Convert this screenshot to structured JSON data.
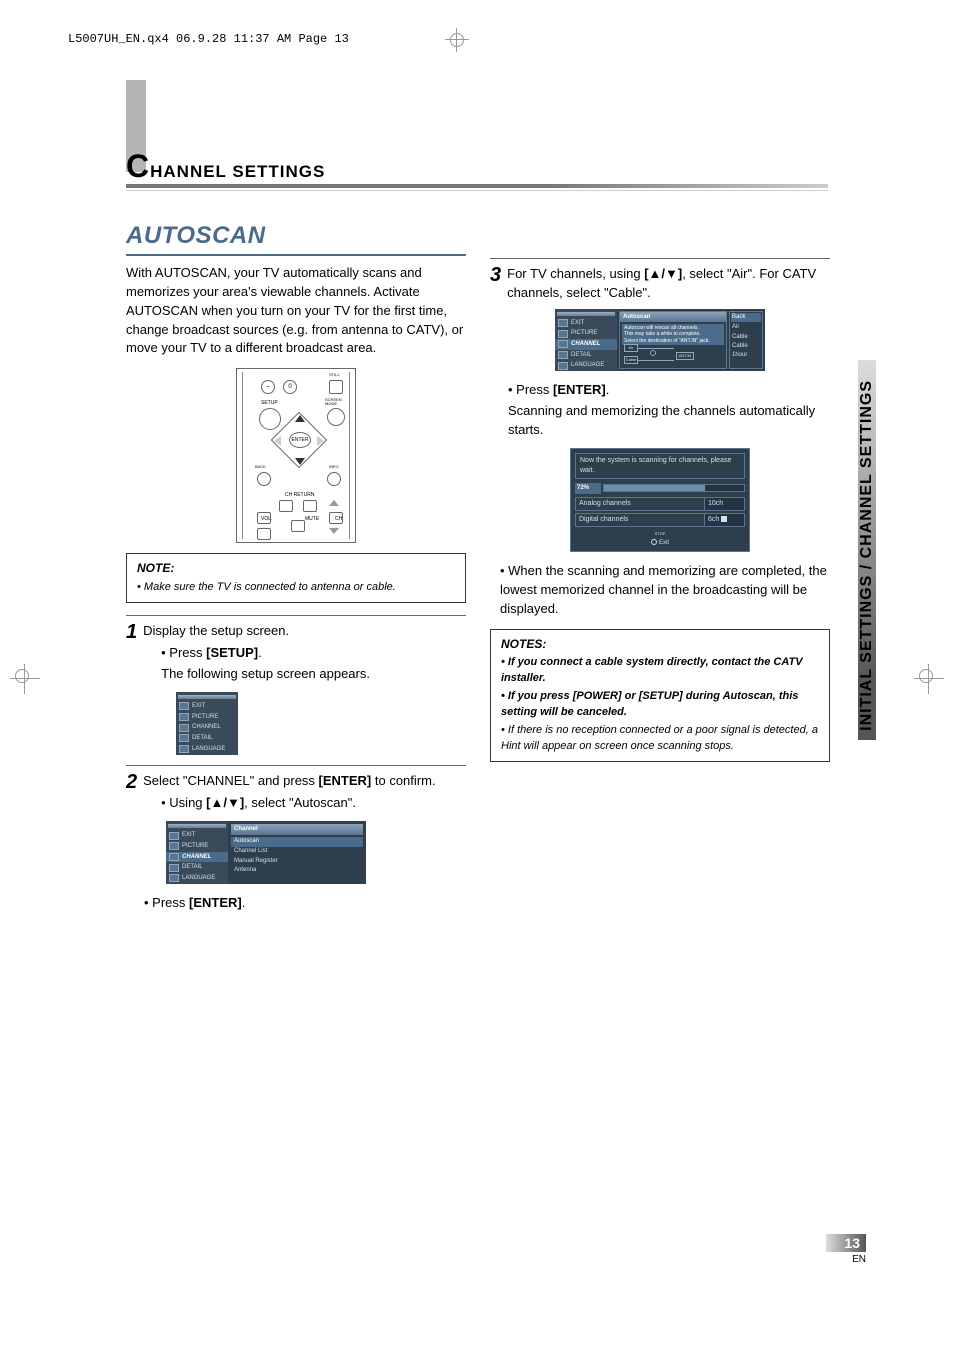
{
  "header": "L5007UH_EN.qx4  06.9.28  11:37 AM  Page 13",
  "chapter_title": "HANNEL SETTINGS",
  "section_title": "AUTOSCAN",
  "intro": "With AUTOSCAN, your TV automatically scans and memorizes your area's viewable channels. Activate AUTOSCAN when you turn on your TV for the first time, change broadcast sources (e.g. from antenna to CATV), or move your TV to a different broadcast area.",
  "remote": {
    "still": "STILL",
    "setup": "SETUP",
    "screen_mode": "SCREEN MODE",
    "enter": "ENTER",
    "back": "BACK",
    "info": "INFO",
    "ch_return": "CH RETURN",
    "vol": "VOL.",
    "mute": "MUTE",
    "ch": "CH"
  },
  "note1": {
    "heading": "NOTE:",
    "body": "• Make sure the TV is connected to antenna or cable."
  },
  "step1": {
    "num": "1",
    "text": "Display the setup screen.",
    "bullet": "• Press ",
    "bold": "[SETUP]",
    "after": ".",
    "sub": "The following setup screen appears."
  },
  "osd_menu": {
    "items": [
      "EXIT",
      "PICTURE",
      "CHANNEL",
      "DETAIL",
      "LANGUAGE"
    ]
  },
  "step2": {
    "num": "2",
    "text_a": "Select \"CHANNEL\" and press ",
    "bold": "[ENTER]",
    "text_b": " to confirm.",
    "bullet_a": "• Using ",
    "bullet_bold": "[▲/▼]",
    "bullet_b": ", select \"Autoscan\"."
  },
  "osd_channel": {
    "title": "Channel",
    "items": [
      "Autoscan",
      "Channel List",
      "Manual Register",
      "Antenna"
    ]
  },
  "step2b": {
    "bullet": "• Press ",
    "bold": "[ENTER]",
    "after": "."
  },
  "step3": {
    "num": "3",
    "text_a": "For TV channels, using ",
    "bold": "[▲/▼]",
    "text_b": ", select \"Air\". For CATV channels, select \"Cable\"."
  },
  "osd_autoscan": {
    "title": "Autoscan",
    "msg1": "Autoscan will rescan all channels.",
    "msg2": "This may take a while to complete.",
    "msg3": "Select the destination of \"ANT.IN\" jack.",
    "air": "Air",
    "cable": "Cable",
    "antin": "ANT.IN",
    "side": [
      "Back",
      "Air",
      "Cable",
      "Cable 1hour"
    ]
  },
  "scan": {
    "msg": "Now the system is scanning for channels, please wait.",
    "pct_label": "72%",
    "pct_value": 72,
    "analog_label": "Analog channels",
    "analog_val": "10ch",
    "digital_label": "Digital channels",
    "digital_val": "6ch",
    "stop": "STOP",
    "exit": "Exit"
  },
  "after_scan": {
    "bullet": "• Press ",
    "bold": "[ENTER]",
    "after": ".",
    "sub": "Scanning and memorizing the channels automatically starts."
  },
  "completion": "• When the scanning and memorizing are completed, the lowest memorized channel in the broadcasting will be displayed.",
  "notes2": {
    "heading": "NOTES:",
    "n1": "• If you connect a cable system directly, contact the CATV installer.",
    "n2": "• If you press [POWER] or [SETUP] during Autoscan, this setting will be canceled.",
    "n3": "• If there is no reception connected or a poor signal is detected, a Hint will appear on screen once scanning stops."
  },
  "side_label": "INITIAL SETTINGS / CHANNEL SETTINGS",
  "page_number": "13",
  "page_lang": "EN"
}
